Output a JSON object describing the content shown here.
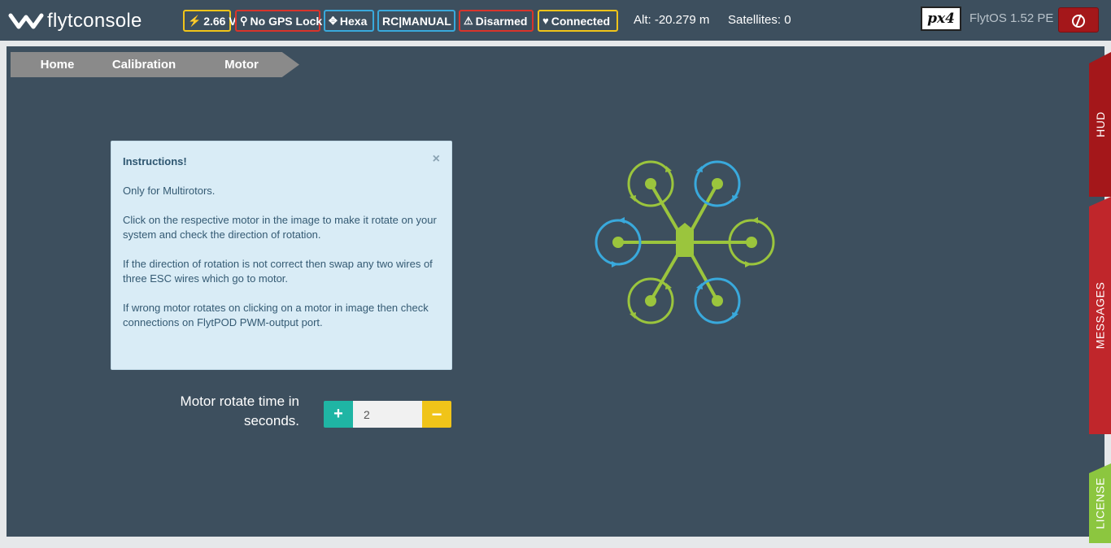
{
  "app": {
    "logo_text": "flytconsole"
  },
  "status": {
    "voltage": "2.66 V",
    "gps": "No GPS Lock",
    "frame": "Hexa",
    "mode": "RC|MANUAL",
    "armed": "Disarmed",
    "connection": "Connected",
    "altitude": "Alt: -20.279 m",
    "satellites": "Satellites: 0"
  },
  "brand": {
    "px4_logo": "px4",
    "version": "FlytOS 1.52 PE"
  },
  "breadcrumb": [
    "Home",
    "Calibration",
    "Motor"
  ],
  "instructions": {
    "title": "Instructions!",
    "close": "×",
    "paragraphs": [
      "Only for Multirotors.",
      "Click on the respective motor in the image to make it rotate on your system and check the direction of rotation.",
      "If the direction of rotation is not correct then swap any two wires of three ESC wires which go to motor.",
      "If wrong motor rotates on clicking on a motor in image then check connections on FlytPOD PWM-output port."
    ]
  },
  "motor_rotate": {
    "label": "Motor rotate time in seconds.",
    "value": "2",
    "plus": "+",
    "minus": "−"
  },
  "side_tabs": {
    "hud": "HUD",
    "messages": "MESSAGES",
    "license": "LICENSE"
  },
  "colors": {
    "topbar": "#3d4f5e",
    "panel": "#3d4f5e",
    "motor_cw": "#9bc53d",
    "motor_ccw": "#39a9dc",
    "danger": "#a4171a",
    "accent_teal": "#1fb5a4",
    "accent_yellow": "#f0c419"
  },
  "icons": {
    "voltage": "bolt-icon",
    "gps": "map-marker-icon",
    "frame": "arrows-icon",
    "armed": "warning-icon",
    "connection": "heart-icon",
    "power": "power-icon"
  }
}
